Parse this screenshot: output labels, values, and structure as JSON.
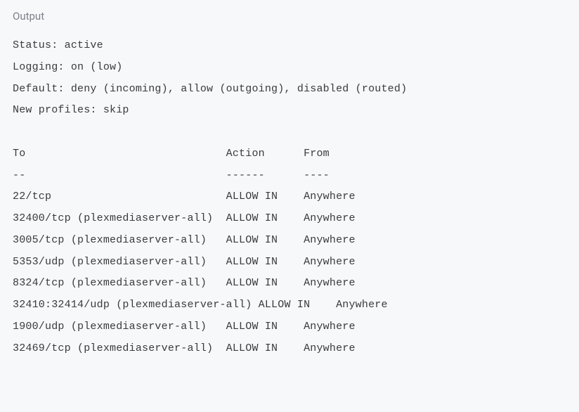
{
  "label": "Output",
  "status_line": "Status: active",
  "logging_line": "Logging: on (low)",
  "default_line": "Default: deny (incoming), allow (outgoing), disabled (routed)",
  "newprofiles_line": "New profiles: skip",
  "header_line": "To                               Action      From",
  "divider_line": "--                               ------      ----",
  "rules": [
    "22/tcp                           ALLOW IN    Anywhere",
    "32400/tcp (plexmediaserver-all)  ALLOW IN    Anywhere",
    "3005/tcp (plexmediaserver-all)   ALLOW IN    Anywhere",
    "5353/udp (plexmediaserver-all)   ALLOW IN    Anywhere",
    "8324/tcp (plexmediaserver-all)   ALLOW IN    Anywhere",
    "32410:32414/udp (plexmediaserver-all) ALLOW IN    Anywhere",
    "1900/udp (plexmediaserver-all)   ALLOW IN    Anywhere",
    "32469/tcp (plexmediaserver-all)  ALLOW IN    Anywhere"
  ]
}
